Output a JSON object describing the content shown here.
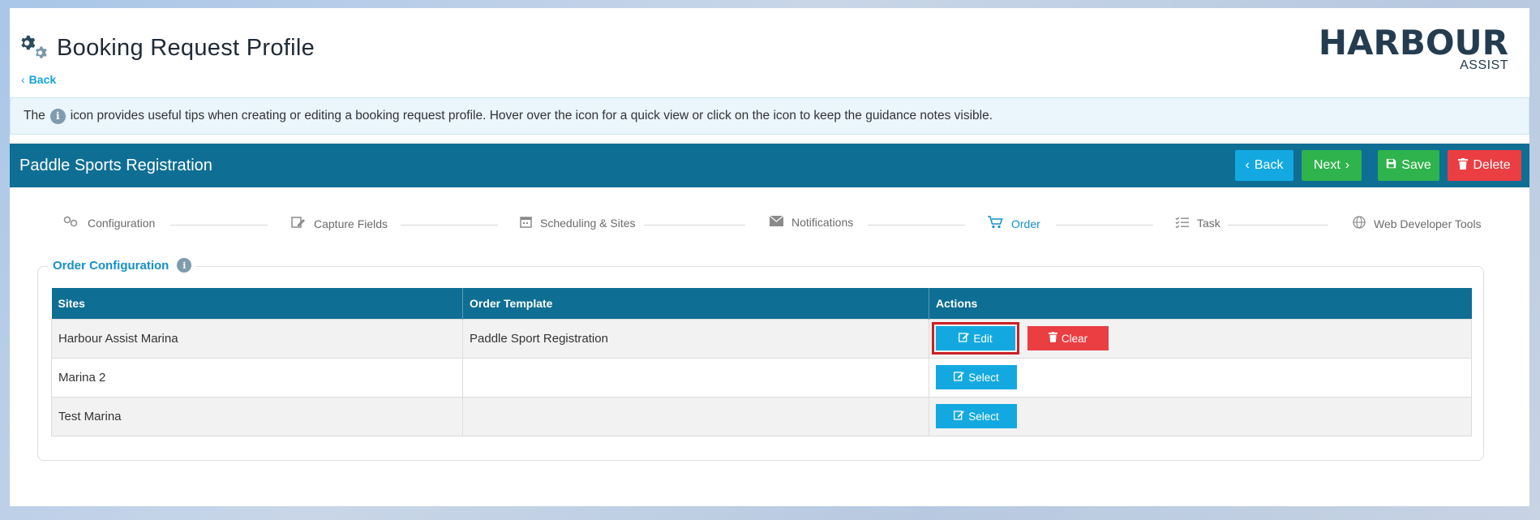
{
  "header": {
    "title": "Booking Request Profile",
    "back_label": "Back",
    "logo_main": "HARBOUR",
    "logo_sub": "ASSIST"
  },
  "info": {
    "prefix": "The",
    "icon_label": "i",
    "text": "icon provides useful tips when creating or editing a booking request profile. Hover over the icon for a quick view or click on the icon to keep the guidance notes visible."
  },
  "profile": {
    "name": "Paddle Sports Registration",
    "buttons": {
      "back": "Back",
      "next": "Next",
      "save": "Save",
      "delete": "Delete"
    }
  },
  "steps": [
    {
      "label": "Configuration",
      "icon": "gears-icon"
    },
    {
      "label": "Capture Fields",
      "icon": "edit-form-icon"
    },
    {
      "label": "Scheduling & Sites",
      "icon": "calendar-icon"
    },
    {
      "label": "Notifications",
      "icon": "envelope-icon"
    },
    {
      "label": "Order",
      "icon": "cart-icon",
      "active": true
    },
    {
      "label": "Task",
      "icon": "checklist-icon"
    },
    {
      "label": "Web Developer Tools",
      "icon": "globe-icon"
    }
  ],
  "order_config": {
    "title": "Order Configuration",
    "columns": [
      "Sites",
      "Order Template",
      "Actions"
    ],
    "rows": [
      {
        "site": "Harbour Assist Marina",
        "template": "Paddle Sport Registration",
        "actions": [
          "Edit",
          "Clear"
        ]
      },
      {
        "site": "Marina 2",
        "template": "",
        "actions": [
          "Select"
        ]
      },
      {
        "site": "Test Marina",
        "template": "",
        "actions": [
          "Select"
        ]
      }
    ]
  },
  "colors": {
    "primary_bar": "#0f6e94",
    "accent_blue": "#13a9e0",
    "green": "#2fb34c",
    "red": "#ea3e43",
    "link": "#15a3d6"
  }
}
